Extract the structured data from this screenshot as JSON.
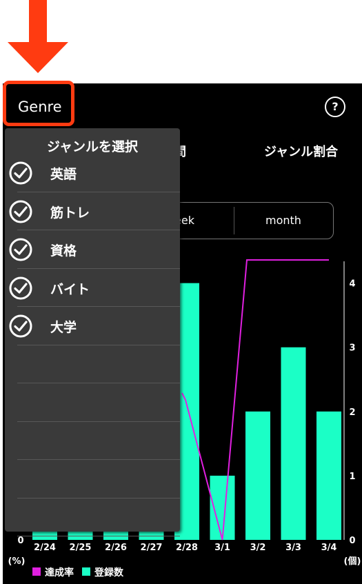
{
  "header": {
    "title": "Genre",
    "help_icon": "?"
  },
  "tabs": [
    {
      "label": "時間"
    },
    {
      "label": "ジャンル割合"
    }
  ],
  "period_selector": {
    "options": [
      "week",
      "month"
    ],
    "visible_week_fragment": "eek"
  },
  "dropdown": {
    "title": "ジャンルを選択",
    "items": [
      {
        "label": "英語",
        "checked": true
      },
      {
        "label": "筋トレ",
        "checked": true
      },
      {
        "label": "資格",
        "checked": true
      },
      {
        "label": "バイト",
        "checked": true
      },
      {
        "label": "大学",
        "checked": true
      }
    ]
  },
  "colors": {
    "accent_arrow": "#ff3b11",
    "bar": "#1bffc6",
    "line": "#e020e0",
    "background": "#000000"
  },
  "chart_data": {
    "type": "bar",
    "categories": [
      "2/24",
      "2/25",
      "2/26",
      "2/27",
      "2/28",
      "3/1",
      "3/2",
      "3/3",
      "3/4"
    ],
    "series": [
      {
        "name": "登録数",
        "type": "bar",
        "axis": "right",
        "values": [
          0,
          0,
          0,
          0,
          4,
          1,
          2,
          3,
          2
        ]
      },
      {
        "name": "達成率",
        "type": "line",
        "axis": "left",
        "values": [
          null,
          null,
          null,
          null,
          50,
          0,
          100,
          100,
          100
        ]
      }
    ],
    "right_axis": {
      "label": "(個)",
      "ticks": [
        "0",
        "1",
        "2",
        "3",
        "4"
      ],
      "ylim": [
        0,
        4.2
      ]
    },
    "left_axis": {
      "label": "(%)",
      "ticks": [
        "0"
      ]
    },
    "legend": [
      {
        "name": "達成率",
        "color": "#e020e0"
      },
      {
        "name": "登録数",
        "color": "#1bffc6"
      }
    ]
  }
}
